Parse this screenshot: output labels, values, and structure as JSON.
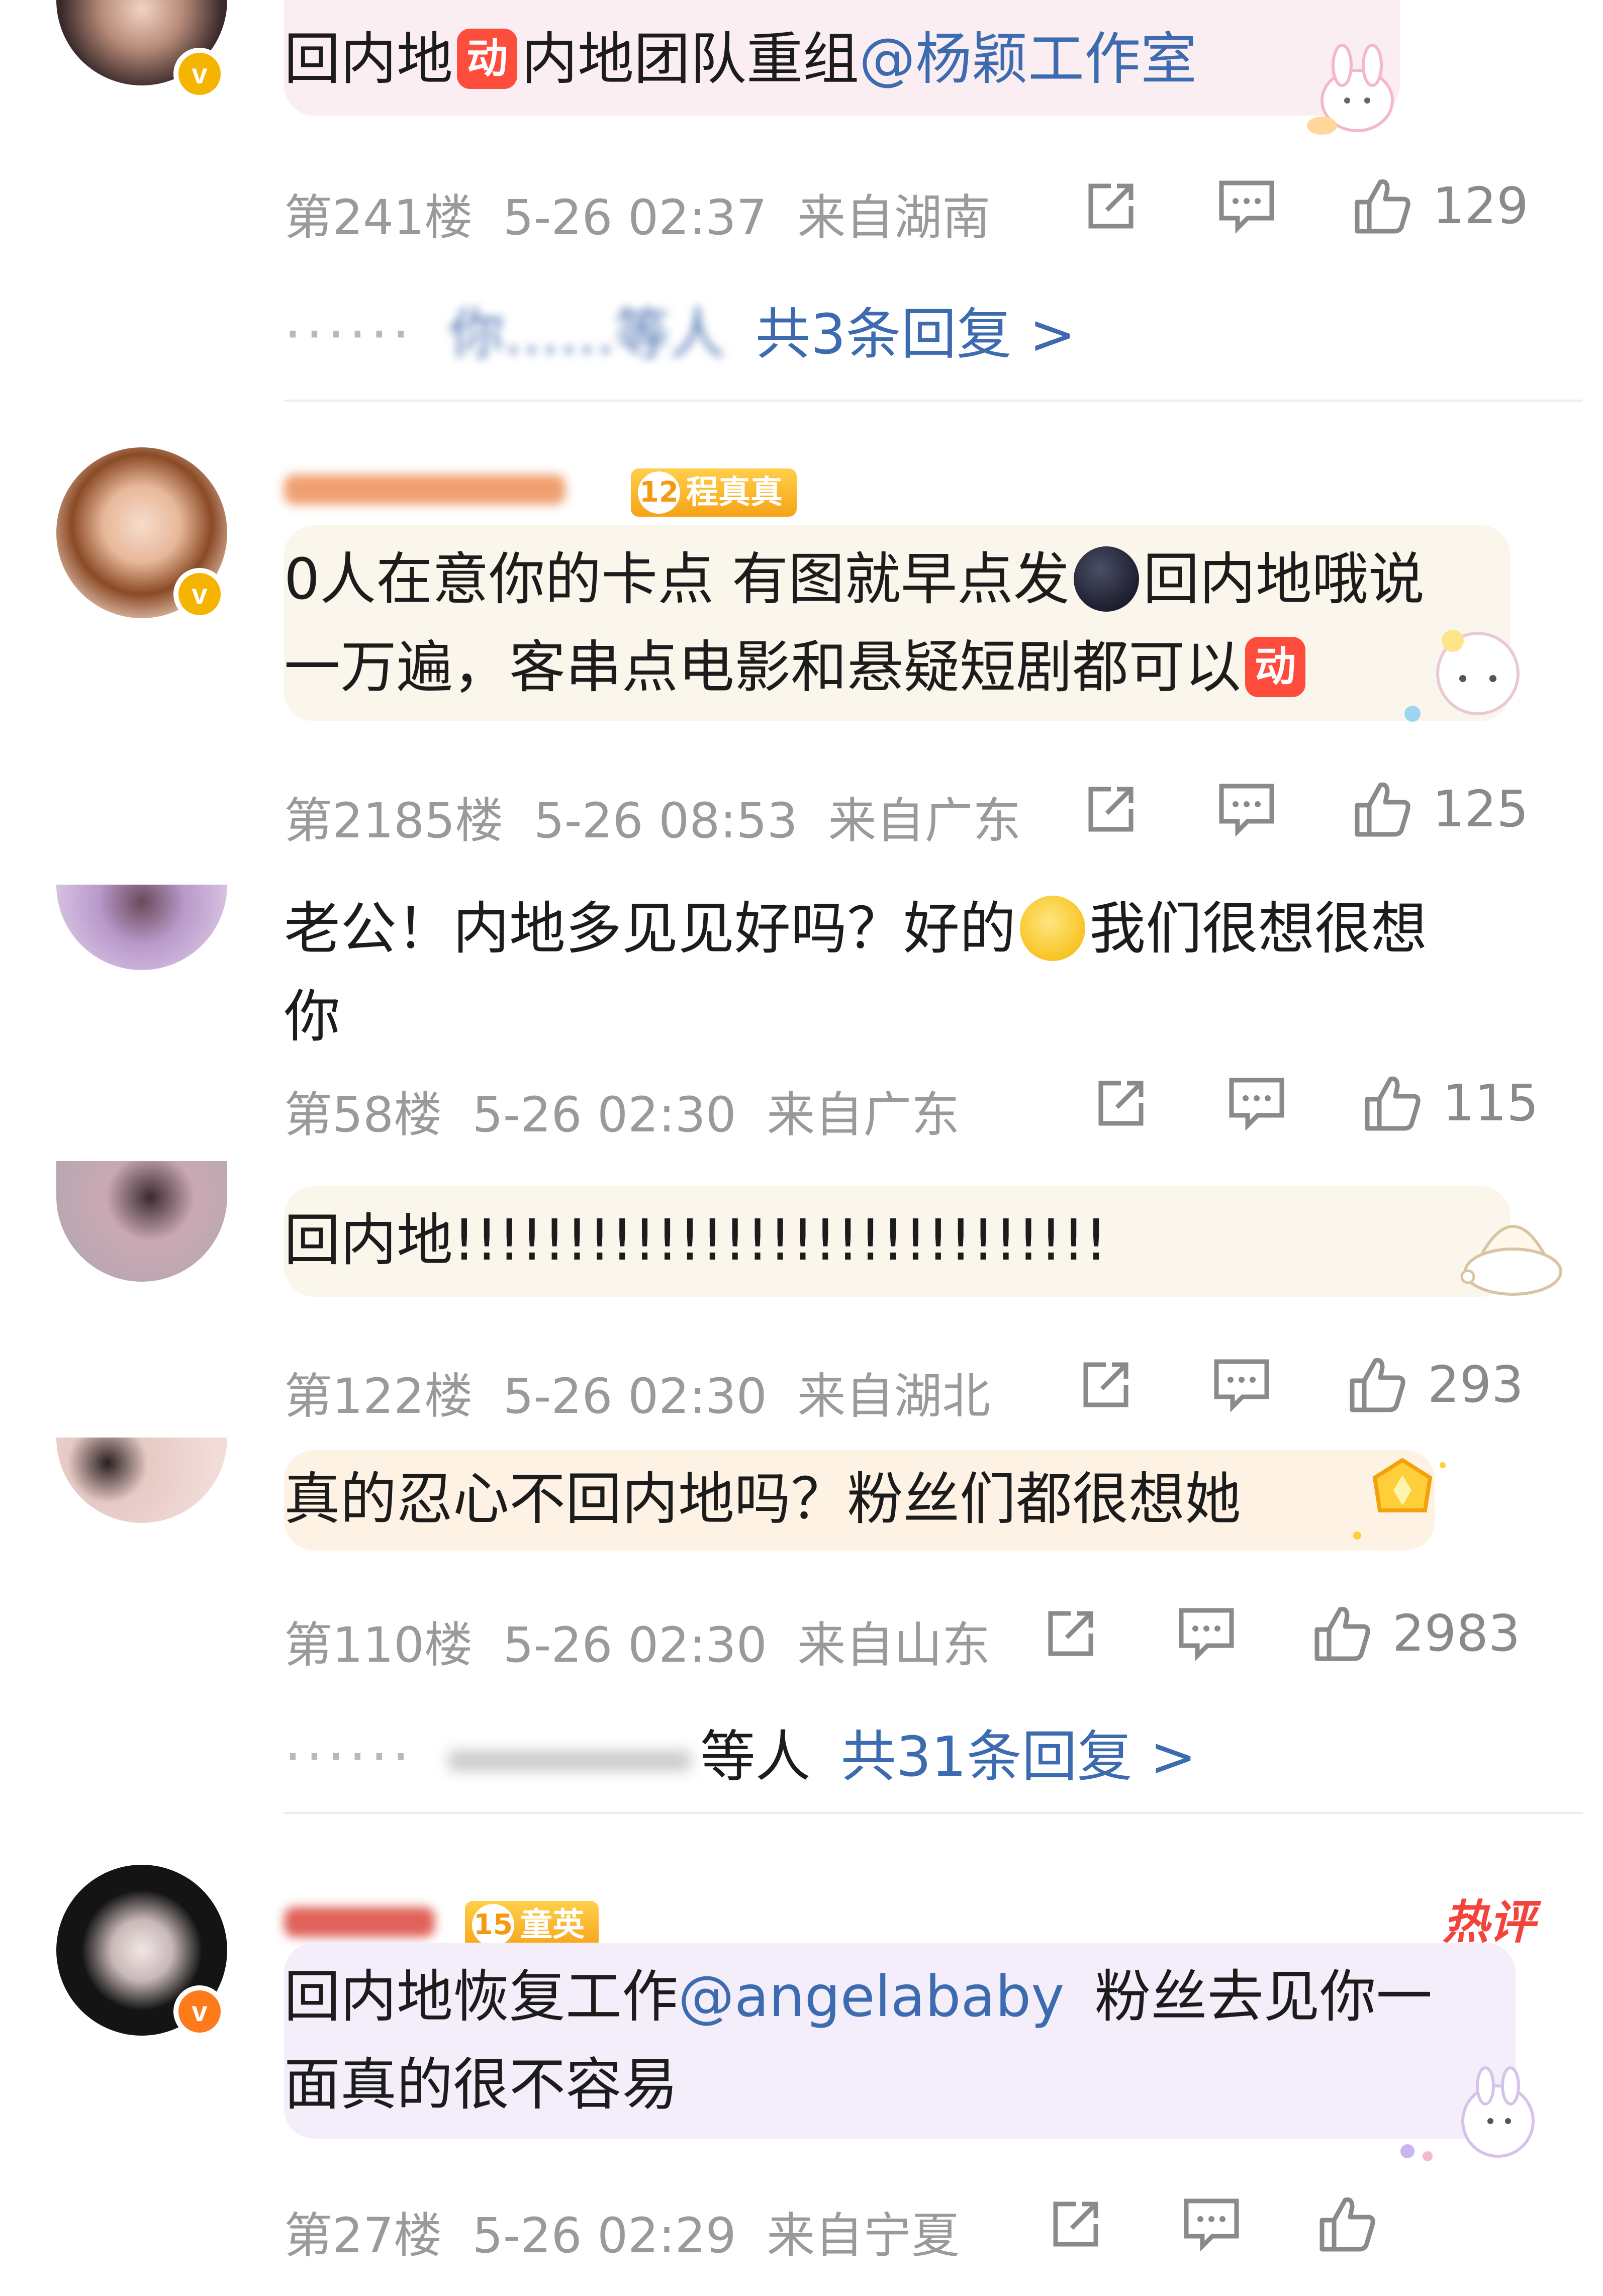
{
  "icons": {
    "share": "share-icon",
    "comment": "comment-icon",
    "like": "thumbs-up-icon"
  },
  "colors": {
    "link": "#3d6bb0",
    "meta": "#9a9a9a",
    "hot": "#f2443c",
    "fan_badge": "#f6a318"
  },
  "comments": [
    {
      "parts": [
        {
          "text": "回内地"
        },
        {
          "badge": "动"
        },
        {
          "text": "内地团队重组"
        },
        {
          "mention": "@杨颖工作室"
        }
      ],
      "floor": "第241楼",
      "date": "5-26 02:37",
      "location": "来自湖南",
      "likes": "129",
      "replies_who": "你……等人",
      "replies_link": "共3条回复 >"
    },
    {
      "fan_badge_level": "12",
      "fan_badge_label": "程真真",
      "line1": "0人在意你的卡点 有图就早点发",
      "line1b": "回内地哦说",
      "line2": "一万遍，客串点电影和悬疑短剧都可以",
      "badge": "动",
      "floor": "第2185楼",
      "date": "5-26 08:53",
      "location": "来自广东",
      "likes": "125"
    },
    {
      "line1a": "老公！内地多见见好吗？好的",
      "line1b": "我们很想很想",
      "line2": "你",
      "floor": "第58楼",
      "date": "5-26 02:30",
      "location": "来自广东",
      "likes": "115"
    },
    {
      "text": "回内地!!!!!!!!!!!!!!!!!!!!!!!!!!!!!",
      "floor": "第122楼",
      "date": "5-26 02:30",
      "location": "来自湖北",
      "likes": "293"
    },
    {
      "text": "真的忍心不回内地吗？粉丝们都很想她",
      "floor": "第110楼",
      "date": "5-26 02:30",
      "location": "来自山东",
      "likes": "2983",
      "replies_who": "等人",
      "replies_link": "共31条回复 >"
    },
    {
      "fan_badge_level": "15",
      "fan_badge_label": "童英",
      "hot_tag": "热评",
      "line1a": "回内地恢复工作",
      "line1_mention": "@angelababy",
      "line1b": "粉丝去见你一",
      "line2": "面真的很不容易",
      "floor": "第27楼",
      "date": "5-26 02:29",
      "location": "来自宁夏",
      "likes": ""
    }
  ]
}
